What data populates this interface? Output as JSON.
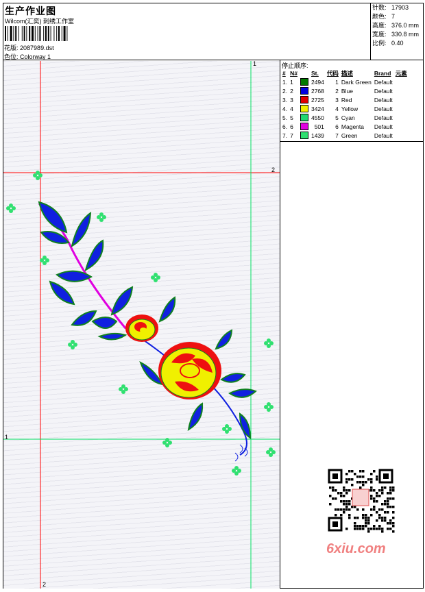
{
  "header": {
    "title": "生产作业图",
    "subtitle": "Wilcom(汇奕) 刺绣工作室",
    "design_label": "花版:",
    "design_value": "2087989.dst",
    "colorway_label": "色位:",
    "colorway_value": "Colorway 1"
  },
  "stats": [
    {
      "label": "针数:",
      "value": "17903"
    },
    {
      "label": "颜色:",
      "value": "7"
    },
    {
      "label": "高度:",
      "value": "376.0 mm"
    },
    {
      "label": "宽度:",
      "value": "330.8 mm"
    },
    {
      "label": "比例:",
      "value": "0.40"
    }
  ],
  "stop_sequence": {
    "title": "停止顺序:",
    "headers": [
      "#",
      "N#",
      "St.",
      "代码",
      "描述",
      "Brand",
      "元素"
    ],
    "rows": [
      {
        "idx": "1.",
        "n": "1",
        "color": "#007a00",
        "st": "2494",
        "code": "1",
        "desc": "Dark Green",
        "brand": "Default"
      },
      {
        "idx": "2.",
        "n": "2",
        "color": "#0000e0",
        "st": "2768",
        "code": "2",
        "desc": "Blue",
        "brand": "Default"
      },
      {
        "idx": "3.",
        "n": "3",
        "color": "#e00000",
        "st": "2725",
        "code": "3",
        "desc": "Red",
        "brand": "Default"
      },
      {
        "idx": "4.",
        "n": "4",
        "color": "#f0f000",
        "st": "3424",
        "code": "4",
        "desc": "Yellow",
        "brand": "Default"
      },
      {
        "idx": "5.",
        "n": "5",
        "color": "#20d870",
        "st": "4550",
        "code": "5",
        "desc": "Cyan",
        "brand": "Default"
      },
      {
        "idx": "6.",
        "n": "6",
        "color": "#e000e0",
        "st": "501",
        "code": "6",
        "desc": "Magenta",
        "brand": "Default"
      },
      {
        "idx": "7.",
        "n": "7",
        "color": "#30e070",
        "st": "1439",
        "code": "7",
        "desc": "Green",
        "brand": "Default"
      }
    ]
  },
  "guides": {
    "green_top": "1",
    "green_bottom_left": "1",
    "red_right": "2",
    "red_bottom": "2"
  },
  "watermark": "6xiu.com",
  "colors": {
    "red_guide": "#ff0000",
    "green_guide": "#00e060",
    "leaf_blue": "#1020e0",
    "leaf_green": "#108020",
    "stem": "#e000e0",
    "petal_yellow": "#f0f000",
    "petal_red": "#ee1010",
    "sparkle": "#30e070"
  }
}
